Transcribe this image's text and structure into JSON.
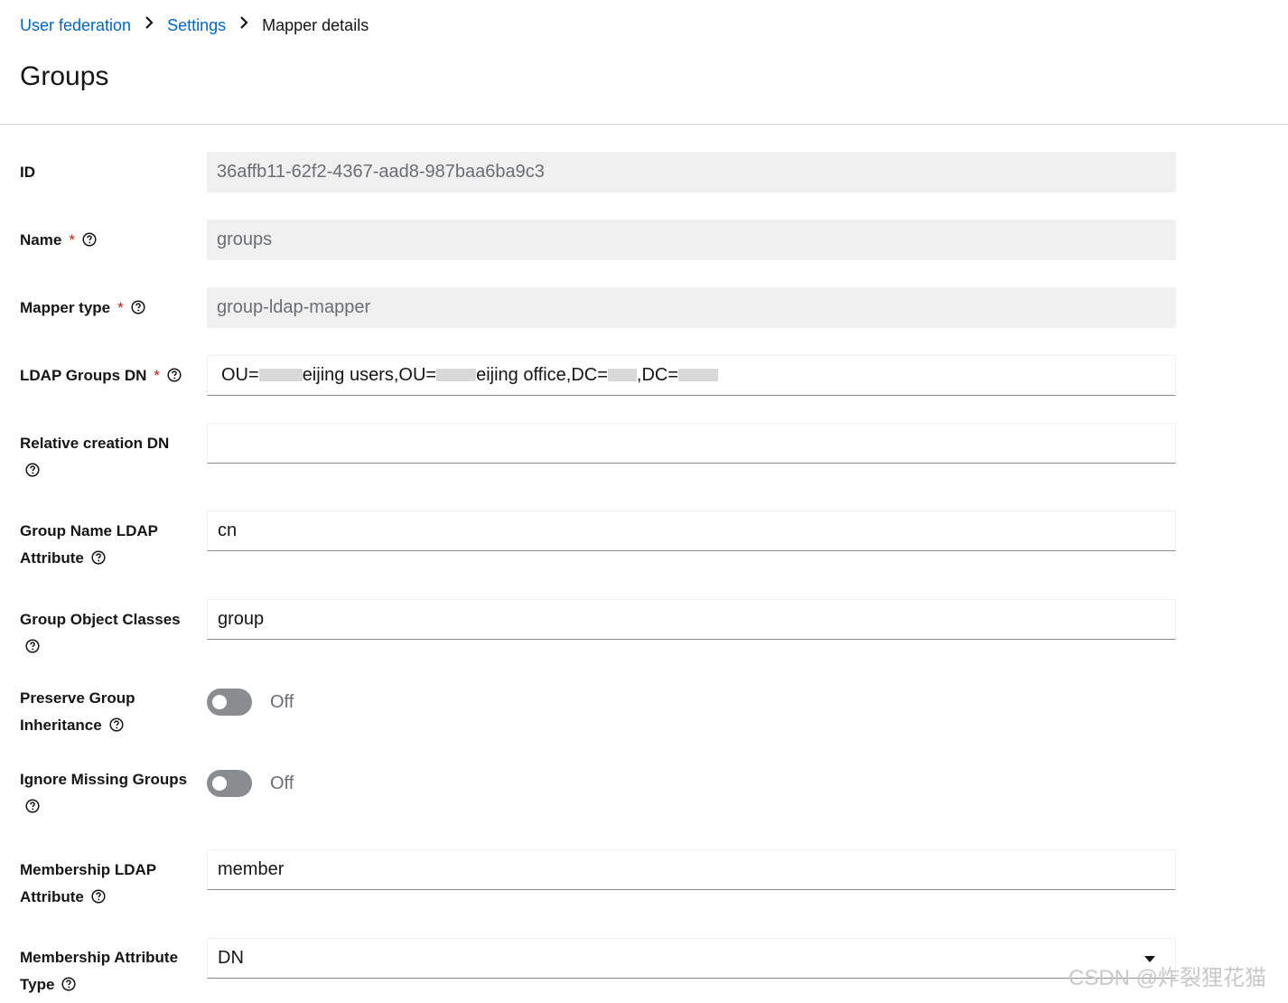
{
  "breadcrumb": {
    "items": [
      "User federation",
      "Settings"
    ],
    "current": "Mapper details"
  },
  "page_title": "Groups",
  "form": {
    "id": {
      "label": "ID",
      "value": "36affb11-62f2-4367-aad8-987baa6ba9c3"
    },
    "name": {
      "label": "Name",
      "required_mark": "*",
      "value": "groups"
    },
    "mapper_type": {
      "label": "Mapper type",
      "required_mark": "*",
      "value": "group-ldap-mapper"
    },
    "ldap_groups_dn": {
      "label": "LDAP Groups DN",
      "required_mark": "*",
      "value_segments": [
        "OU=",
        "eijing users,OU=",
        "eijing office,DC=",
        ",DC="
      ]
    },
    "relative_creation_dn": {
      "label": "Relative creation DN",
      "value": ""
    },
    "group_name_ldap_attribute": {
      "label_line1": "Group Name LDAP",
      "label_line2": "Attribute",
      "value": "cn"
    },
    "group_object_classes": {
      "label": "Group Object Classes",
      "value": "group"
    },
    "preserve_group_inheritance": {
      "label_line1": "Preserve Group",
      "label_line2": "Inheritance",
      "state": "Off"
    },
    "ignore_missing_groups": {
      "label": "Ignore Missing Groups",
      "state": "Off"
    },
    "membership_ldap_attribute": {
      "label_line1": "Membership LDAP",
      "label_line2": "Attribute",
      "value": "member"
    },
    "membership_attribute_type": {
      "label_line1": "Membership Attribute",
      "label_line2": "Type",
      "selected": "DN"
    }
  },
  "watermark": "CSDN @炸裂狸花猫",
  "colors": {
    "link": "#0066cc",
    "required": "#c9190b",
    "readonly_bg": "#f0f0f0",
    "switch_off": "#8a8d90",
    "text": "#151515"
  },
  "icons": {
    "help": "help-circle-icon",
    "breadcrumb_separator": "chevron-right-icon",
    "select_caret": "caret-down-icon"
  }
}
